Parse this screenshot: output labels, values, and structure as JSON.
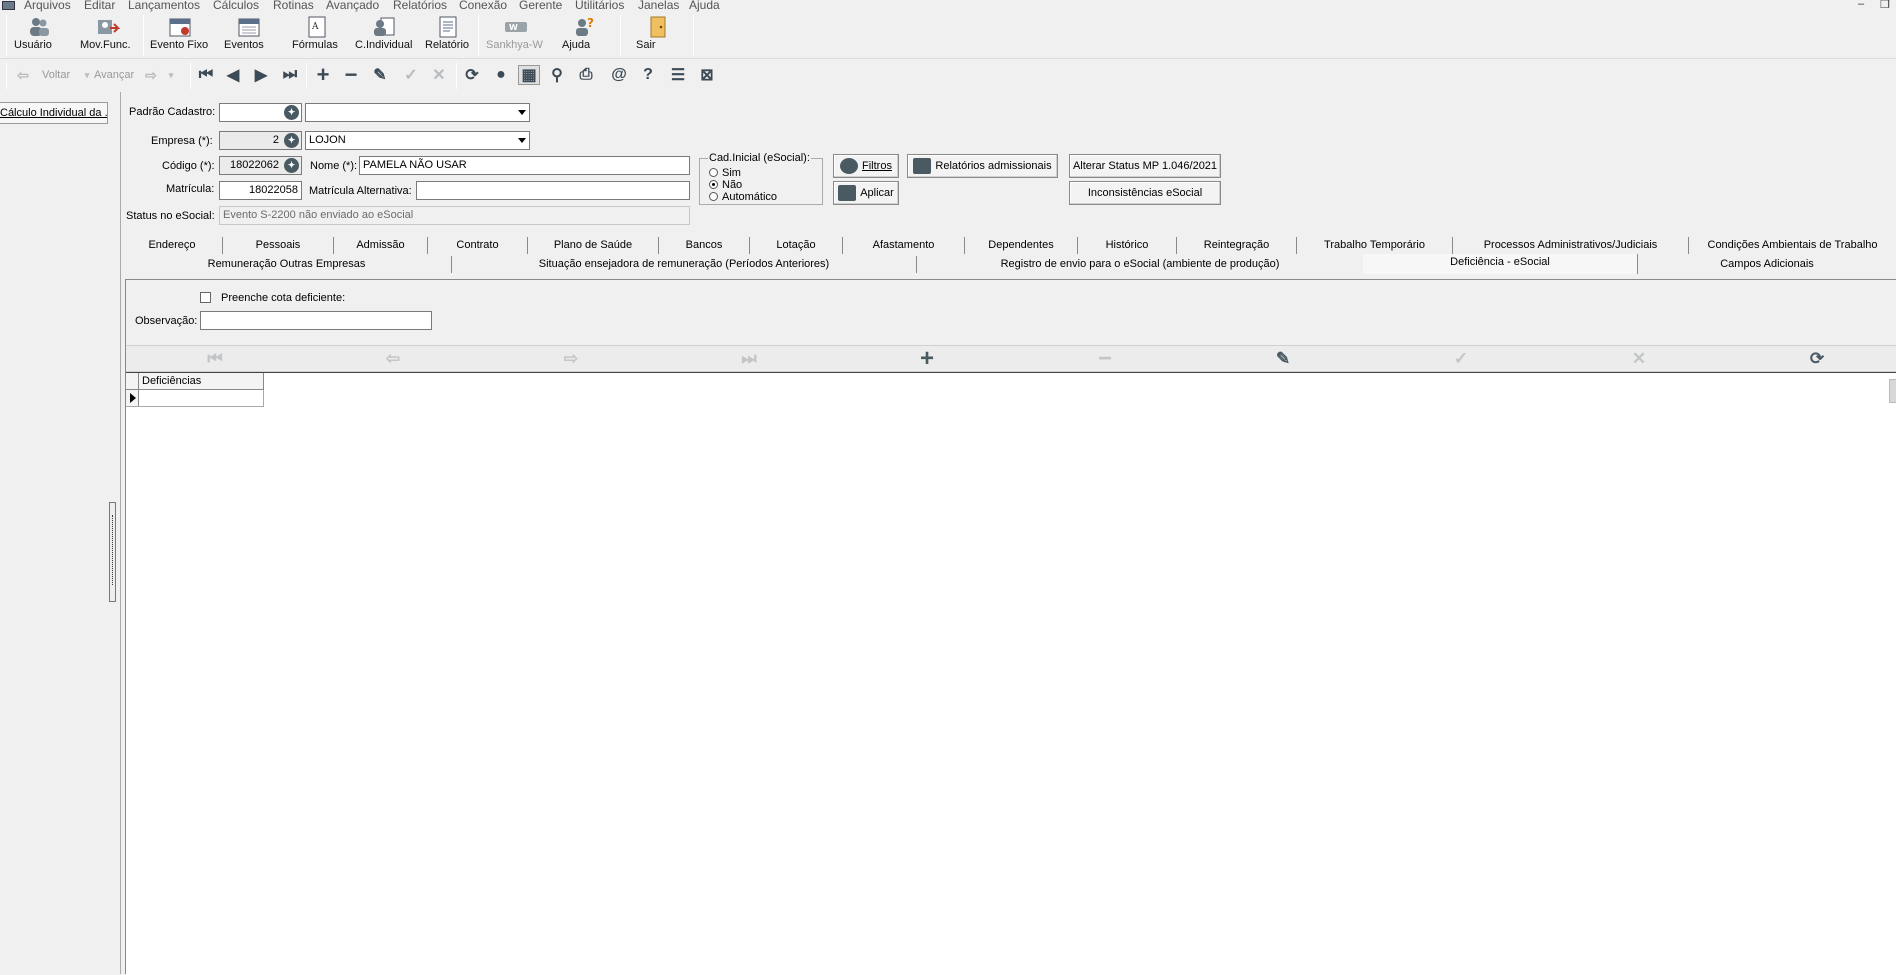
{
  "menu": [
    "Arquivos",
    "Editar",
    "Lançamentos",
    "Cálculos",
    "Rotinas",
    "Avançado",
    "Relatórios",
    "Conexão",
    "Gerente",
    "Utilitários",
    "Janelas",
    "Ajuda"
  ],
  "window_controls": {
    "minimize": "–",
    "restore": "❐"
  },
  "toolbar": [
    {
      "label": "Usuário",
      "icon": "users-icon"
    },
    {
      "label": "Mov.Func.",
      "icon": "employee-move-icon"
    },
    {
      "label": "Evento Fixo",
      "icon": "calendar-fixed-icon"
    },
    {
      "label": "Eventos",
      "icon": "calendar-icon"
    },
    {
      "label": "Fórmulas",
      "icon": "formula-icon"
    },
    {
      "label": "C.Individual",
      "icon": "individual-calc-icon"
    },
    {
      "label": "Relatório",
      "icon": "report-icon"
    },
    {
      "label": "Sankhya-W",
      "icon": "sankhya-logo-icon"
    },
    {
      "label": "Ajuda",
      "icon": "help-person-icon"
    },
    {
      "label": "Sair",
      "icon": "exit-door-icon"
    }
  ],
  "nav": {
    "back_label": "Voltar",
    "forward_label": "Avançar"
  },
  "left_tab": "Cálculo Individual da ...",
  "form": {
    "padrao_label": "Padrão Cadastro:",
    "padrao_code": "",
    "padrao_value": "",
    "empresa_label": "Empresa (*):",
    "empresa_code": "2",
    "empresa_value": "LOJON",
    "codigo_label": "Código (*):",
    "codigo_value": "18022062",
    "nome_label": "Nome (*):",
    "nome_value": "PAMELA  NÃO USAR",
    "matricula_label": "Matrícula:",
    "matricula_value": "18022058",
    "matricula_alt_label": "Matrícula Alternativa:",
    "matricula_alt_value": "",
    "status_label": "Status no eSocial:",
    "status_value": "Evento S-2200 não enviado ao eSocial"
  },
  "cad_inicial": {
    "title": "Cad.Inicial (eSocial):",
    "options": [
      "Sim",
      "Não",
      "Automático"
    ],
    "selected": "Não"
  },
  "buttons": {
    "filtros": "Filtros",
    "aplicar": "Aplicar",
    "relatorios": "Relatórios admissionais",
    "alterar_status": "Alterar Status MP 1.046/2021",
    "inconsistencias": "Inconsistências eSocial"
  },
  "tabs_row1": [
    "Endereço",
    "Pessoais",
    "Admissão",
    "Contrato",
    "Plano de Saúde",
    "Bancos",
    "Lotação",
    "Afastamento",
    "Dependentes",
    "Histórico",
    "Reintegração",
    "Trabalho Temporário",
    "Processos Administrativos/Judiciais",
    "Condições Ambientais de Trabalho"
  ],
  "tabs_row2": [
    "Remuneração Outras Empresas",
    "Situação ensejadora de remuneração (Períodos Anteriores)",
    "Registro de envio para o eSocial (ambiente de produção)",
    "Deficiência - eSocial",
    "Campos Adicionais"
  ],
  "active_tab": "Deficiência - eSocial",
  "deficiencia": {
    "checkbox_label": "Preenche cota deficiente:",
    "checkbox_checked": false,
    "observacao_label": "Observação:",
    "observacao_value": "",
    "grid_column": "Deficiências"
  }
}
